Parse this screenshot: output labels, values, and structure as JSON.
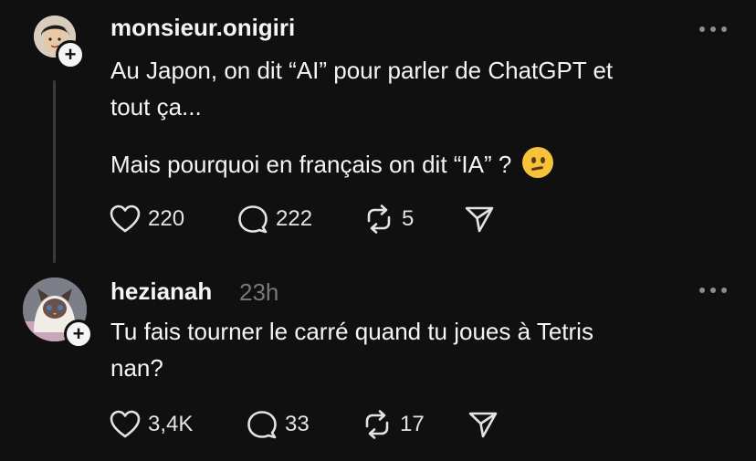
{
  "posts": [
    {
      "username": "monsieur.onigiri",
      "time": "",
      "text_lines": [
        "Au Japon, on dit “AI” pour parler de ChatGPT et\ntout ça...",
        "Mais pourquoi en français on dit “IA” ?"
      ],
      "emoji": "thinking-face",
      "likes": "220",
      "comments": "222",
      "reposts": "5"
    },
    {
      "username": "hezianah",
      "time": "23h",
      "text": "Tu fais tourner le carré quand tu joues à Tetris\nnan?",
      "likes": "3,4K",
      "comments": "33",
      "reposts": "17"
    }
  ],
  "icons": {
    "like": "heart-icon",
    "comment": "comment-bubble-icon",
    "repost": "repost-icon",
    "share": "paper-plane-icon",
    "more": "more-dots-icon",
    "follow": "plus-icon"
  },
  "colors": {
    "background": "#101010",
    "text": "#f3f5f7",
    "muted": "#777777"
  }
}
